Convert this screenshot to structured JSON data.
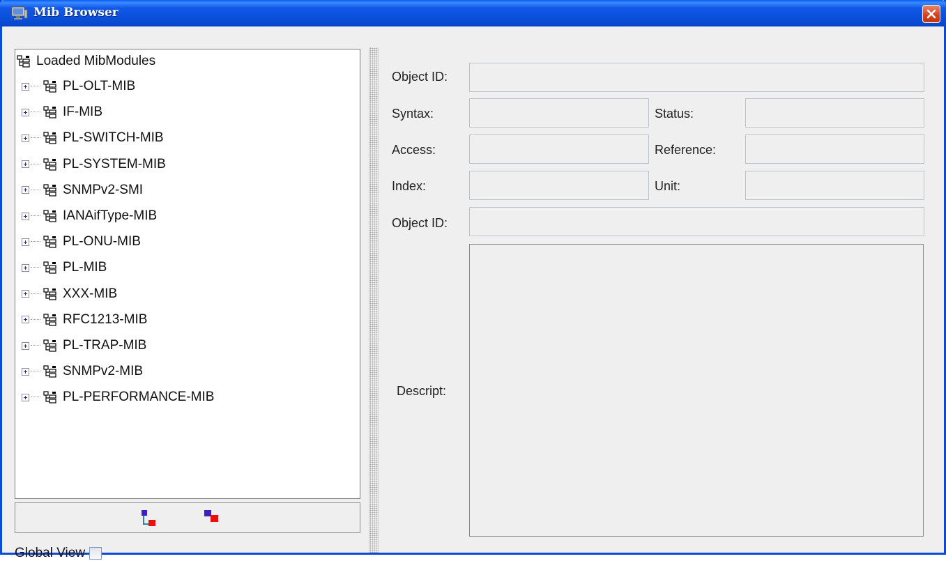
{
  "window": {
    "title": "Mib Browser"
  },
  "tree": {
    "root_label": "Loaded MibModules",
    "modules": [
      "PL-OLT-MIB",
      "IF-MIB",
      "PL-SWITCH-MIB",
      "PL-SYSTEM-MIB",
      "SNMPv2-SMI",
      "IANAifType-MIB",
      "PL-ONU-MIB",
      "PL-MIB",
      "XXX-MIB",
      "RFC1213-MIB",
      "PL-TRAP-MIB",
      "SNMPv2-MIB",
      "PL-PERFORMANCE-MIB"
    ]
  },
  "global_view": {
    "label": "Global View",
    "checked": false
  },
  "details": {
    "object_id_label": "Object ID:",
    "object_id_value": "",
    "syntax_label": "Syntax:",
    "syntax_value": "",
    "status_label": "Status:",
    "status_value": "",
    "access_label": "Access:",
    "access_value": "",
    "reference_label": "Reference:",
    "reference_value": "",
    "index_label": "Index:",
    "index_value": "",
    "unit_label": "Unit:",
    "unit_value": "",
    "object_id2_label": "Object ID:",
    "object_id2_value": "",
    "descript_label": "Descript:",
    "descript_value": ""
  },
  "icons": {
    "title": "monitor-icon",
    "close": "close-icon",
    "node": "mib-tree-icon",
    "expand_all": "expand-tree-icon",
    "collapse_all": "collapse-tree-icon"
  }
}
